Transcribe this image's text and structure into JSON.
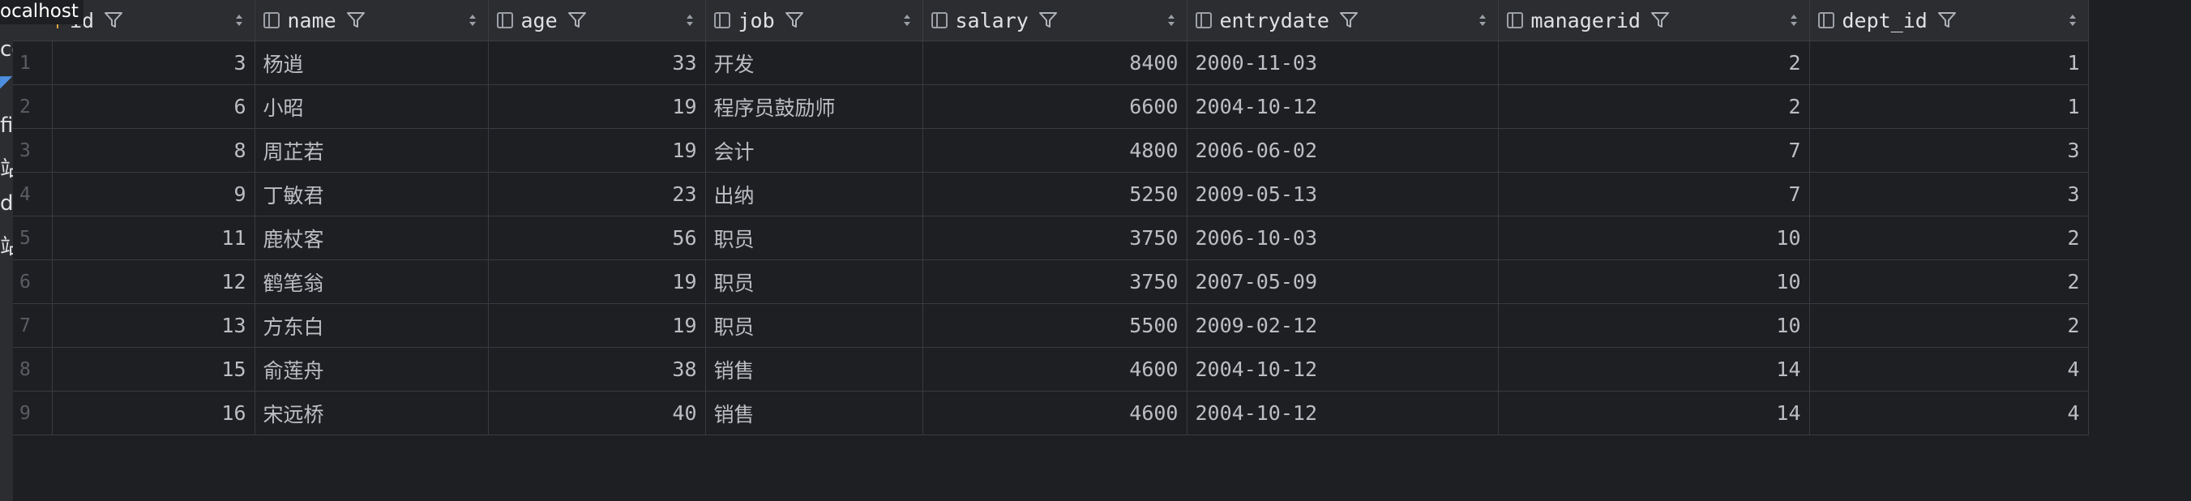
{
  "tooltip": "ocalhost",
  "sidebar": {
    "items": [
      {
        "label": "co"
      },
      {
        "label": "◤"
      },
      {
        "label": "fi"
      },
      {
        "label": "站"
      },
      {
        "label": "de"
      },
      {
        "label": "站"
      }
    ]
  },
  "columns": [
    {
      "label": "id",
      "icon": "key-icon"
    },
    {
      "label": "name",
      "icon": "column-icon"
    },
    {
      "label": "age",
      "icon": "column-icon"
    },
    {
      "label": "job",
      "icon": "column-icon"
    },
    {
      "label": "salary",
      "icon": "column-icon"
    },
    {
      "label": "entrydate",
      "icon": "column-icon"
    },
    {
      "label": "managerid",
      "icon": "column-icon"
    },
    {
      "label": "dept_id",
      "icon": "column-icon"
    }
  ],
  "rows": [
    {
      "n": "1",
      "id": "3",
      "name": "杨逍",
      "age": "33",
      "job": "开发",
      "salary": "8400",
      "entrydate": "2000-11-03",
      "managerid": "2",
      "dept_id": "1"
    },
    {
      "n": "2",
      "id": "6",
      "name": "小昭",
      "age": "19",
      "job": "程序员鼓励师",
      "salary": "6600",
      "entrydate": "2004-10-12",
      "managerid": "2",
      "dept_id": "1"
    },
    {
      "n": "3",
      "id": "8",
      "name": "周芷若",
      "age": "19",
      "job": "会计",
      "salary": "4800",
      "entrydate": "2006-06-02",
      "managerid": "7",
      "dept_id": "3"
    },
    {
      "n": "4",
      "id": "9",
      "name": "丁敏君",
      "age": "23",
      "job": "出纳",
      "salary": "5250",
      "entrydate": "2009-05-13",
      "managerid": "7",
      "dept_id": "3"
    },
    {
      "n": "5",
      "id": "11",
      "name": "鹿杖客",
      "age": "56",
      "job": "职员",
      "salary": "3750",
      "entrydate": "2006-10-03",
      "managerid": "10",
      "dept_id": "2"
    },
    {
      "n": "6",
      "id": "12",
      "name": "鹤笔翁",
      "age": "19",
      "job": "职员",
      "salary": "3750",
      "entrydate": "2007-05-09",
      "managerid": "10",
      "dept_id": "2"
    },
    {
      "n": "7",
      "id": "13",
      "name": "方东白",
      "age": "19",
      "job": "职员",
      "salary": "5500",
      "entrydate": "2009-02-12",
      "managerid": "10",
      "dept_id": "2"
    },
    {
      "n": "8",
      "id": "15",
      "name": "俞莲舟",
      "age": "38",
      "job": "销售",
      "salary": "4600",
      "entrydate": "2004-10-12",
      "managerid": "14",
      "dept_id": "4"
    },
    {
      "n": "9",
      "id": "16",
      "name": "宋远桥",
      "age": "40",
      "job": "销售",
      "salary": "4600",
      "entrydate": "2004-10-12",
      "managerid": "14",
      "dept_id": "4"
    }
  ]
}
